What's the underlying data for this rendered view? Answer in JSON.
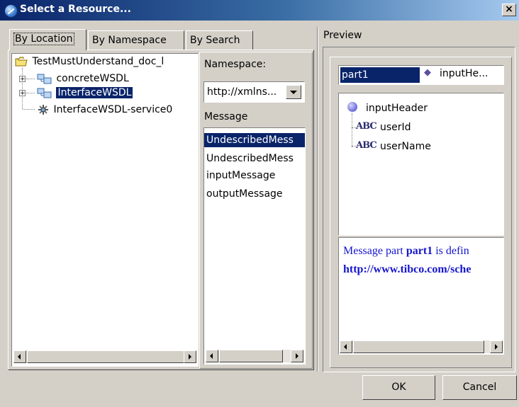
{
  "window": {
    "title": "Select a Resource...",
    "close_glyph": "×"
  },
  "tabs": [
    {
      "label": "By Location",
      "selected": true
    },
    {
      "label": "By Namespace",
      "selected": false
    },
    {
      "label": "By Search",
      "selected": false
    }
  ],
  "tree": {
    "root": {
      "label": "TestMustUnderstand_doc_l",
      "icon": "folder-icon"
    },
    "items": [
      {
        "label": "concreteWSDL",
        "icon": "wsdl-icon",
        "expandable": true,
        "selected": false
      },
      {
        "label": "InterfaceWSDL",
        "icon": "wsdl-icon",
        "expandable": true,
        "selected": true
      },
      {
        "label": "InterfaceWSDL-service0",
        "icon": "service-icon",
        "expandable": false,
        "selected": false
      }
    ]
  },
  "namespace": {
    "label": "Namespace:",
    "value": "http://xmlns..."
  },
  "message": {
    "label": "Message",
    "items": [
      {
        "label": "UndescribedMess",
        "selected": true
      },
      {
        "label": "UndescribedMess",
        "selected": false
      },
      {
        "label": "inputMessage",
        "selected": false
      },
      {
        "label": "outputMessage",
        "selected": false
      }
    ]
  },
  "preview": {
    "title": "Preview",
    "part_name": "part1",
    "part_element": "inputHe...",
    "schema": {
      "root": "inputHeader",
      "children": [
        "userId",
        "userName"
      ]
    },
    "description": {
      "text_prefix": "Message part ",
      "part_bold": "part1",
      "text_suffix": " is defin",
      "link": "http://www.tibco.com/sche"
    }
  },
  "colors": {
    "selection": "#0a246a",
    "description_text": "#1515cc"
  },
  "buttons": {
    "ok": "OK",
    "cancel": "Cancel"
  }
}
